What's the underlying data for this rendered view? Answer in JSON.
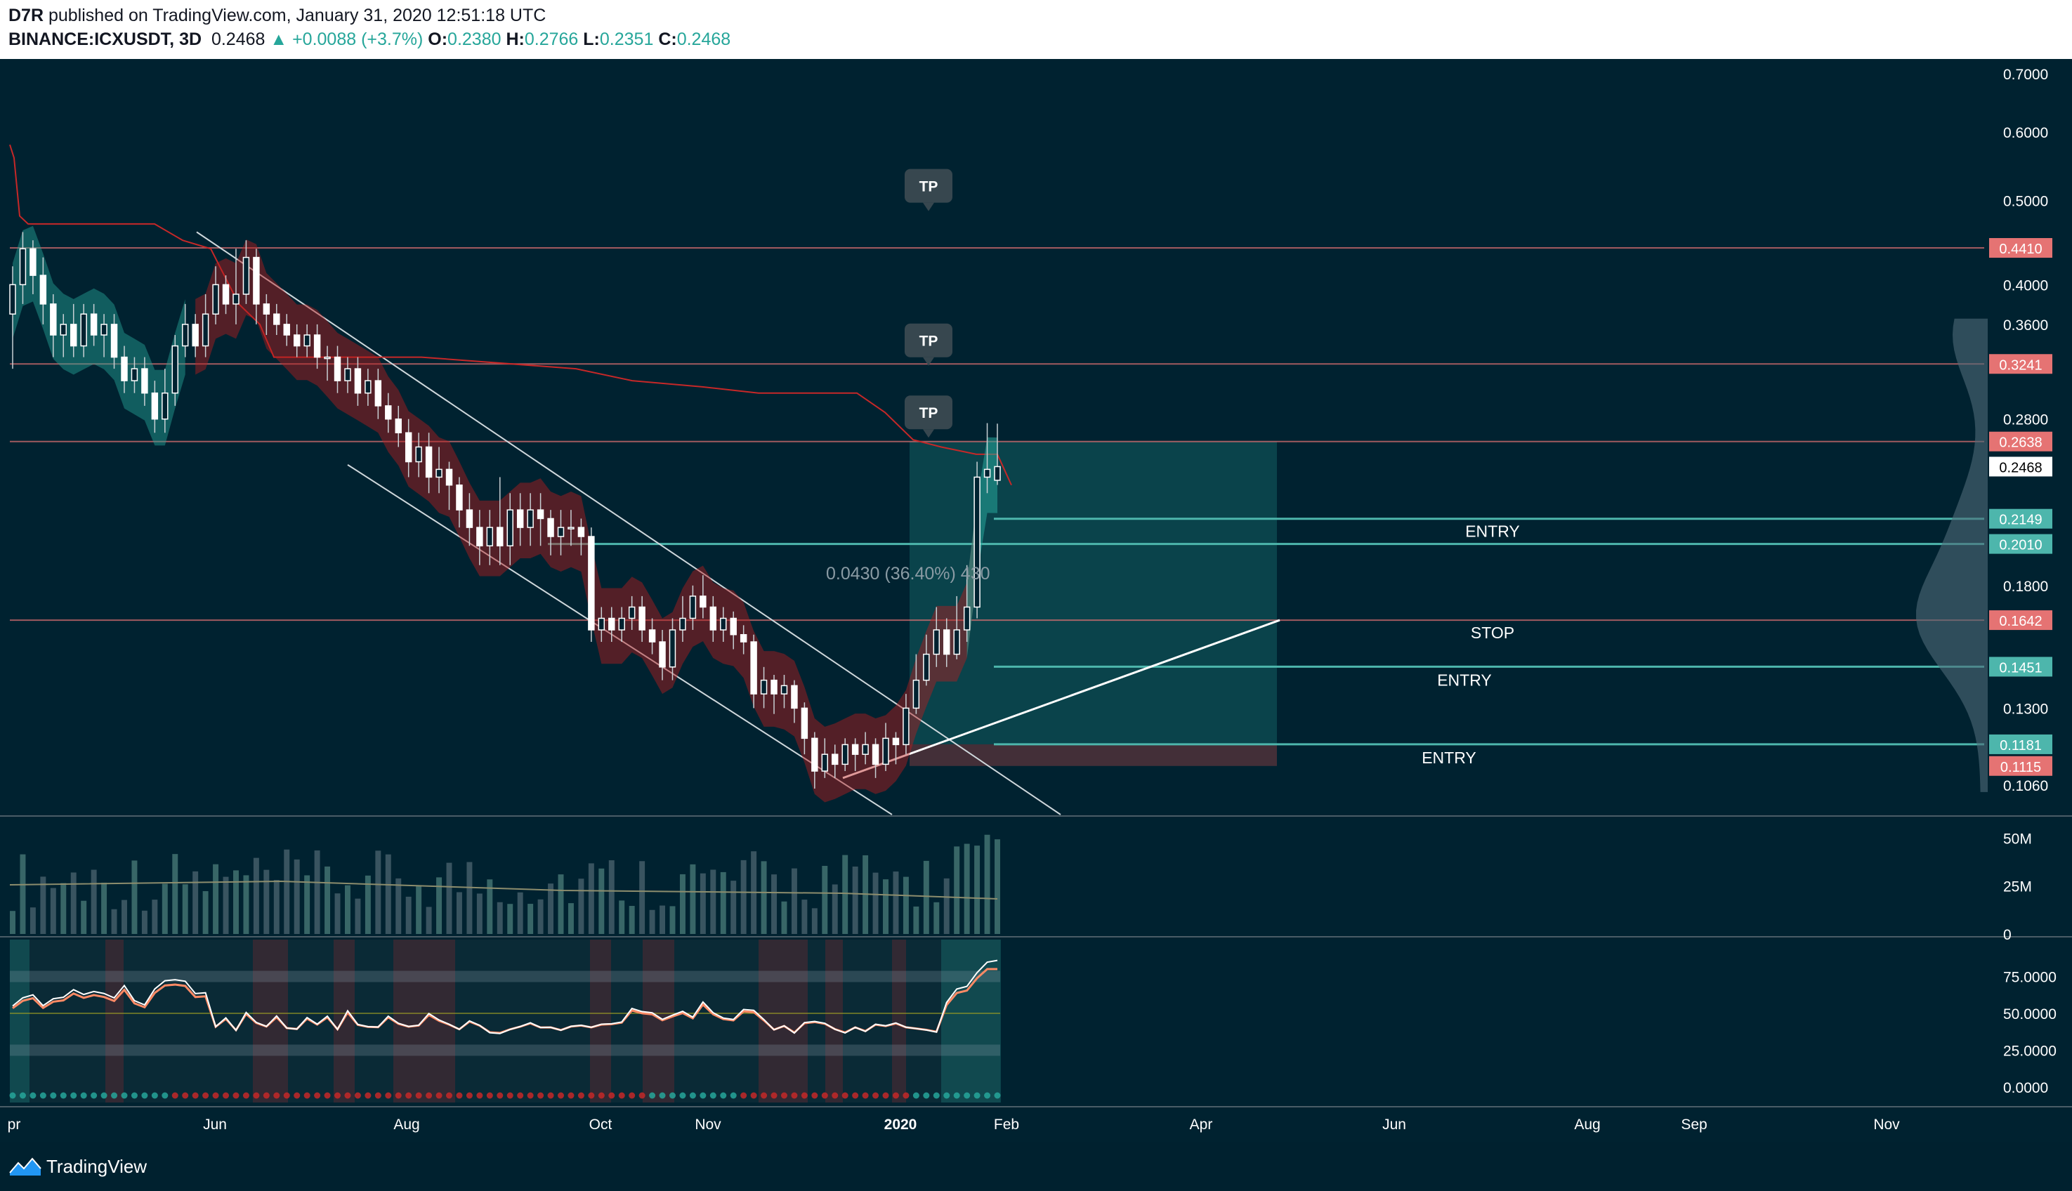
{
  "header": {
    "author": "D7R",
    "published": "published on TradingView.com, January 31, 2020 12:51:18 UTC",
    "symbol": "BINANCE:ICXUSDT, 3D",
    "last": "0.2468",
    "change_arrow": "▲",
    "change": "+0.0088 (+3.7%)",
    "o_label": "O:",
    "o_value": "0.2380",
    "h_label": "H:",
    "h_value": "0.2766",
    "l_label": "L:",
    "l_value": "0.2351",
    "c_label": "C:",
    "c_value": "0.2468"
  },
  "footer": {
    "brand": "TradingView",
    "logo_icon": "tradingview-logo-icon"
  },
  "colors": {
    "background": "#002230",
    "bull": "#26a69a",
    "bear": "#ef5350",
    "candle": "#ffffff",
    "level_red": "#e57373",
    "level_teal": "#4db6ac"
  },
  "chart_data": {
    "type": "candlestick",
    "symbol": "BINANCE:ICXUSDT",
    "interval": "3D",
    "y_scale": "log",
    "ylim": [
      0.098,
      0.72
    ],
    "y_ticks": [
      "0.7000",
      "0.6000",
      "0.5000",
      "0.4000",
      "0.3600",
      "0.2800",
      "0.1800",
      "0.1300",
      "0.1060"
    ],
    "x_ticks": [
      "pr",
      "Jun",
      "Aug",
      "Oct",
      "Nov",
      "2020",
      "Feb",
      "Apr",
      "Jun",
      "Aug",
      "Sep",
      "Nov"
    ],
    "grid": false,
    "price_labels": [
      {
        "value": "0.4410",
        "kind": "red"
      },
      {
        "value": "0.3241",
        "kind": "red"
      },
      {
        "value": "0.2638",
        "kind": "red"
      },
      {
        "value": "0.2468",
        "kind": "current"
      },
      {
        "value": "0.2149",
        "kind": "teal"
      },
      {
        "value": "0.2010",
        "kind": "teal"
      },
      {
        "value": "0.1642",
        "kind": "red"
      },
      {
        "value": "0.1451",
        "kind": "teal"
      },
      {
        "value": "0.1181",
        "kind": "teal"
      },
      {
        "value": "0.1115",
        "kind": "red"
      }
    ],
    "levels": [
      {
        "value": 0.441,
        "kind": "red"
      },
      {
        "value": 0.3241,
        "kind": "red"
      },
      {
        "value": 0.2638,
        "kind": "red"
      },
      {
        "value": 0.2149,
        "kind": "teal"
      },
      {
        "value": 0.201,
        "kind": "teal"
      },
      {
        "value": 0.1642,
        "kind": "red"
      },
      {
        "value": 0.1451,
        "kind": "teal"
      },
      {
        "value": 0.1181,
        "kind": "teal"
      }
    ],
    "annotations": {
      "tp": [
        "TP",
        "TP",
        "TP"
      ],
      "entry": [
        "ENTRY",
        "ENTRY",
        "ENTRY"
      ],
      "stop": "STOP",
      "measure": "0.0430 (36.40%) 430"
    },
    "volume_ticks": [
      "50M",
      "25M",
      "0"
    ],
    "oscillator_ticks": [
      "75.0000",
      "50.0000",
      "25.0000",
      "0.0000"
    ],
    "candles": [
      [
        0.37,
        0.4,
        0.32,
        0.42
      ],
      [
        0.4,
        0.44,
        0.38,
        0.46
      ],
      [
        0.44,
        0.41,
        0.39,
        0.45
      ],
      [
        0.41,
        0.38,
        0.36,
        0.43
      ],
      [
        0.38,
        0.35,
        0.33,
        0.39
      ],
      [
        0.35,
        0.36,
        0.33,
        0.37
      ],
      [
        0.36,
        0.34,
        0.33,
        0.38
      ],
      [
        0.34,
        0.37,
        0.33,
        0.38
      ],
      [
        0.37,
        0.35,
        0.34,
        0.38
      ],
      [
        0.35,
        0.36,
        0.33,
        0.37
      ],
      [
        0.36,
        0.33,
        0.32,
        0.37
      ],
      [
        0.33,
        0.31,
        0.3,
        0.34
      ],
      [
        0.31,
        0.32,
        0.3,
        0.33
      ],
      [
        0.32,
        0.3,
        0.29,
        0.33
      ],
      [
        0.3,
        0.28,
        0.27,
        0.31
      ],
      [
        0.28,
        0.3,
        0.27,
        0.32
      ],
      [
        0.3,
        0.34,
        0.29,
        0.35
      ],
      [
        0.34,
        0.36,
        0.33,
        0.38
      ],
      [
        0.36,
        0.34,
        0.33,
        0.37
      ],
      [
        0.34,
        0.37,
        0.33,
        0.39
      ],
      [
        0.37,
        0.4,
        0.36,
        0.42
      ],
      [
        0.4,
        0.38,
        0.37,
        0.41
      ],
      [
        0.38,
        0.39,
        0.36,
        0.44
      ],
      [
        0.39,
        0.43,
        0.38,
        0.45
      ],
      [
        0.43,
        0.38,
        0.36,
        0.44
      ],
      [
        0.38,
        0.37,
        0.35,
        0.39
      ],
      [
        0.37,
        0.36,
        0.35,
        0.38
      ],
      [
        0.36,
        0.35,
        0.34,
        0.37
      ],
      [
        0.35,
        0.34,
        0.33,
        0.36
      ],
      [
        0.34,
        0.35,
        0.33,
        0.36
      ],
      [
        0.35,
        0.33,
        0.32,
        0.36
      ],
      [
        0.33,
        0.33,
        0.31,
        0.34
      ],
      [
        0.33,
        0.31,
        0.3,
        0.34
      ],
      [
        0.31,
        0.32,
        0.3,
        0.33
      ],
      [
        0.32,
        0.3,
        0.29,
        0.33
      ],
      [
        0.3,
        0.31,
        0.29,
        0.32
      ],
      [
        0.31,
        0.29,
        0.28,
        0.32
      ],
      [
        0.29,
        0.28,
        0.27,
        0.3
      ],
      [
        0.28,
        0.27,
        0.26,
        0.29
      ],
      [
        0.27,
        0.25,
        0.24,
        0.28
      ],
      [
        0.25,
        0.26,
        0.24,
        0.27
      ],
      [
        0.26,
        0.24,
        0.23,
        0.27
      ],
      [
        0.24,
        0.245,
        0.23,
        0.26
      ],
      [
        0.245,
        0.235,
        0.22,
        0.25
      ],
      [
        0.235,
        0.22,
        0.21,
        0.24
      ],
      [
        0.22,
        0.21,
        0.2,
        0.23
      ],
      [
        0.21,
        0.2,
        0.19,
        0.22
      ],
      [
        0.2,
        0.21,
        0.19,
        0.22
      ],
      [
        0.21,
        0.2,
        0.19,
        0.24
      ],
      [
        0.2,
        0.22,
        0.19,
        0.23
      ],
      [
        0.22,
        0.21,
        0.2,
        0.23
      ],
      [
        0.21,
        0.22,
        0.2,
        0.23
      ],
      [
        0.22,
        0.215,
        0.2,
        0.23
      ],
      [
        0.215,
        0.205,
        0.195,
        0.22
      ],
      [
        0.205,
        0.21,
        0.195,
        0.22
      ],
      [
        0.21,
        0.21,
        0.2,
        0.22
      ],
      [
        0.21,
        0.205,
        0.195,
        0.215
      ],
      [
        0.205,
        0.16,
        0.155,
        0.21
      ],
      [
        0.16,
        0.165,
        0.155,
        0.17
      ],
      [
        0.165,
        0.16,
        0.155,
        0.17
      ],
      [
        0.16,
        0.165,
        0.155,
        0.17
      ],
      [
        0.165,
        0.17,
        0.16,
        0.175
      ],
      [
        0.17,
        0.16,
        0.155,
        0.175
      ],
      [
        0.16,
        0.155,
        0.15,
        0.165
      ],
      [
        0.155,
        0.145,
        0.14,
        0.16
      ],
      [
        0.145,
        0.16,
        0.14,
        0.165
      ],
      [
        0.16,
        0.165,
        0.155,
        0.175
      ],
      [
        0.165,
        0.175,
        0.16,
        0.18
      ],
      [
        0.175,
        0.17,
        0.165,
        0.185
      ],
      [
        0.17,
        0.16,
        0.155,
        0.175
      ],
      [
        0.16,
        0.165,
        0.155,
        0.17
      ],
      [
        0.165,
        0.158,
        0.152,
        0.168
      ],
      [
        0.158,
        0.155,
        0.15,
        0.162
      ],
      [
        0.155,
        0.135,
        0.13,
        0.158
      ],
      [
        0.135,
        0.14,
        0.13,
        0.145
      ],
      [
        0.14,
        0.135,
        0.128,
        0.142
      ],
      [
        0.135,
        0.138,
        0.13,
        0.142
      ],
      [
        0.138,
        0.13,
        0.125,
        0.14
      ],
      [
        0.13,
        0.12,
        0.115,
        0.132
      ],
      [
        0.12,
        0.11,
        0.105,
        0.122
      ],
      [
        0.11,
        0.115,
        0.108,
        0.12
      ],
      [
        0.115,
        0.112,
        0.108,
        0.118
      ],
      [
        0.112,
        0.118,
        0.11,
        0.12
      ],
      [
        0.118,
        0.115,
        0.11,
        0.12
      ],
      [
        0.115,
        0.118,
        0.112,
        0.122
      ],
      [
        0.118,
        0.112,
        0.108,
        0.12
      ],
      [
        0.112,
        0.12,
        0.11,
        0.125
      ],
      [
        0.12,
        0.118,
        0.112,
        0.122
      ],
      [
        0.118,
        0.13,
        0.115,
        0.135
      ],
      [
        0.13,
        0.14,
        0.128,
        0.15
      ],
      [
        0.14,
        0.15,
        0.138,
        0.158
      ],
      [
        0.15,
        0.16,
        0.145,
        0.17
      ],
      [
        0.16,
        0.15,
        0.145,
        0.165
      ],
      [
        0.15,
        0.16,
        0.148,
        0.175
      ],
      [
        0.16,
        0.17,
        0.155,
        0.19
      ],
      [
        0.17,
        0.24,
        0.165,
        0.25
      ],
      [
        0.24,
        0.245,
        0.23,
        0.277
      ],
      [
        0.238,
        0.2468,
        0.2351,
        0.2766
      ]
    ]
  }
}
